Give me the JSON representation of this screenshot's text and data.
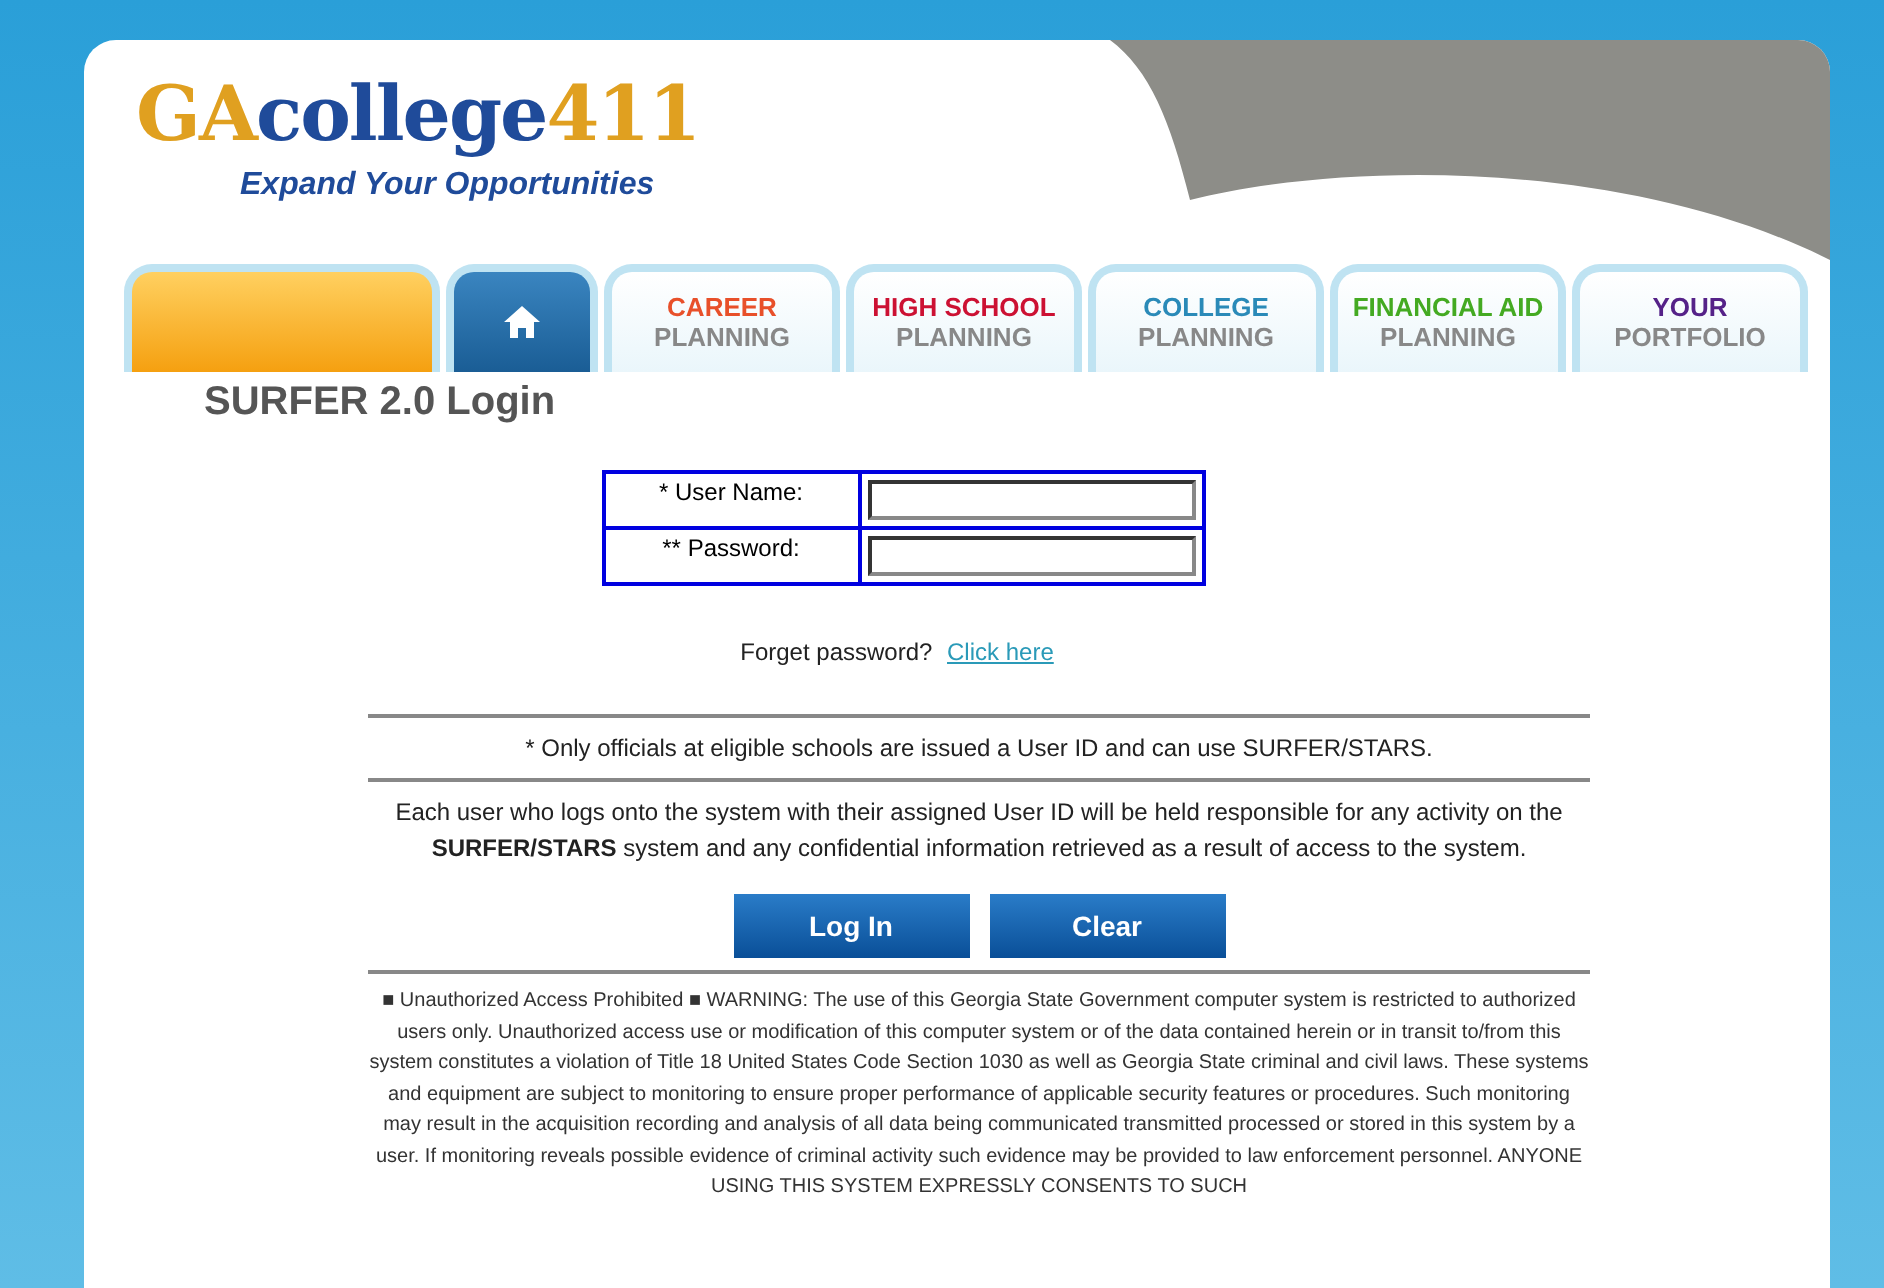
{
  "logo": {
    "parts": [
      {
        "text": "GA",
        "color": "#e0a020"
      },
      {
        "text": "college",
        "color": "#1f4b9a"
      },
      {
        "text": "411",
        "color": "#e0a020"
      }
    ],
    "tagline": "Expand Your Opportunities"
  },
  "tabs": [
    {
      "kind": "blank"
    },
    {
      "kind": "home"
    },
    {
      "kind": "text",
      "top": "CAREER",
      "bottom": "PLANNING",
      "color": "#e8502a"
    },
    {
      "kind": "text",
      "top": "HIGH SCHOOL",
      "bottom": "PLANNING",
      "color": "#cc1133"
    },
    {
      "kind": "text",
      "top": "COLLEGE",
      "bottom": "PLANNING",
      "color": "#2a8ab8"
    },
    {
      "kind": "text",
      "top": "FINANCIAL AID",
      "bottom": "PLANNING",
      "color": "#44aa22"
    },
    {
      "kind": "text",
      "top": "YOUR",
      "bottom": "PORTFOLIO",
      "color": "#552288"
    }
  ],
  "page_title": "SURFER 2.0 Login",
  "form": {
    "fields": [
      {
        "label": "* User Name:"
      },
      {
        "label": "** Password:"
      }
    ]
  },
  "forgot": {
    "text": "Forget password?",
    "link": "Click here"
  },
  "notice": "* Only officials at eligible schools are issued a User ID and can use SURFER/STARS.",
  "responsibility": "Each user who logs onto the system with their assigned User ID will be held responsible for any activity on the **SURFER/STARS** system and any confidential information retrieved as a result of access to the system.",
  "buttons": [
    "Log In",
    "Clear"
  ],
  "warning": "■ Unauthorized Access Prohibited ■ WARNING: The use of this Georgia State Government computer system is restricted to authorized users only. Unauthorized access use or modification of this computer system or of the data contained herein or in transit to/from this system constitutes a violation of Title 18 United States Code Section 1030 as well as Georgia State criminal and civil laws. These systems and equipment are subject to monitoring to ensure proper performance of applicable security features or procedures. Such monitoring may result in the acquisition recording and analysis of all data being communicated transmitted processed or stored in this system by a user. If monitoring reveals possible evidence of criminal activity such evidence may be provided to law enforcement personnel. ANYONE USING THIS SYSTEM EXPRESSLY CONSENTS TO SUCH"
}
